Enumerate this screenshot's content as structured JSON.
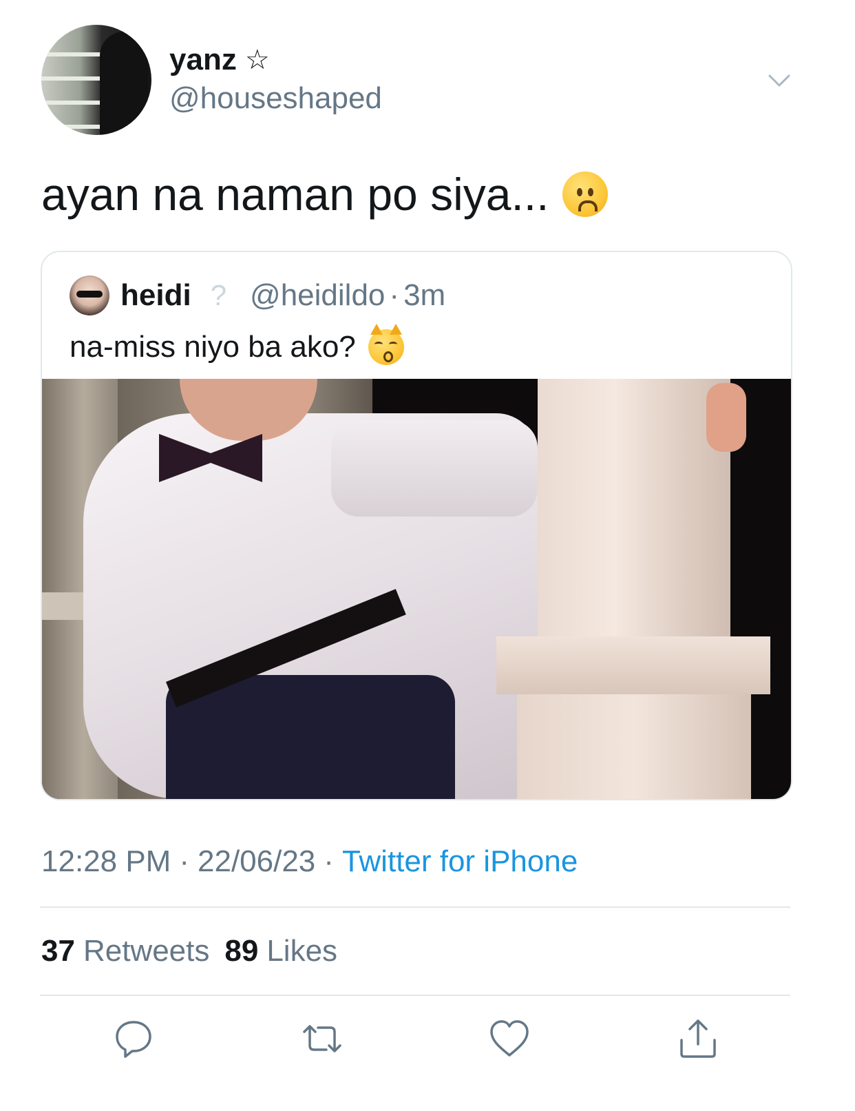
{
  "author": {
    "display_name": "yanz",
    "name_symbol": "☆",
    "handle": "@houseshaped"
  },
  "tweet": {
    "text": "ayan na naman po siya...",
    "emoji": "worried-face-emoji"
  },
  "quoted_tweet": {
    "display_name": "heidi",
    "badge_symbol": "?",
    "handle": "@heidildo",
    "separator": "·",
    "time": "3m",
    "text": "na-miss niyo ba ako?",
    "emoji": "kissing-cat-emoji"
  },
  "meta": {
    "time": "12:28 PM",
    "separator": "·",
    "date": "22/06/23",
    "separator2": "·",
    "source": "Twitter for iPhone"
  },
  "stats": {
    "retweets_count": "37",
    "retweets_label": "Retweets",
    "likes_count": "89",
    "likes_label": "Likes"
  },
  "actions": [
    "reply-icon",
    "retweet-icon",
    "like-icon",
    "share-icon"
  ],
  "colors": {
    "text_primary": "#14171a",
    "text_secondary": "#657786",
    "link_blue": "#1b95e0",
    "divider": "#e1e8ed"
  }
}
